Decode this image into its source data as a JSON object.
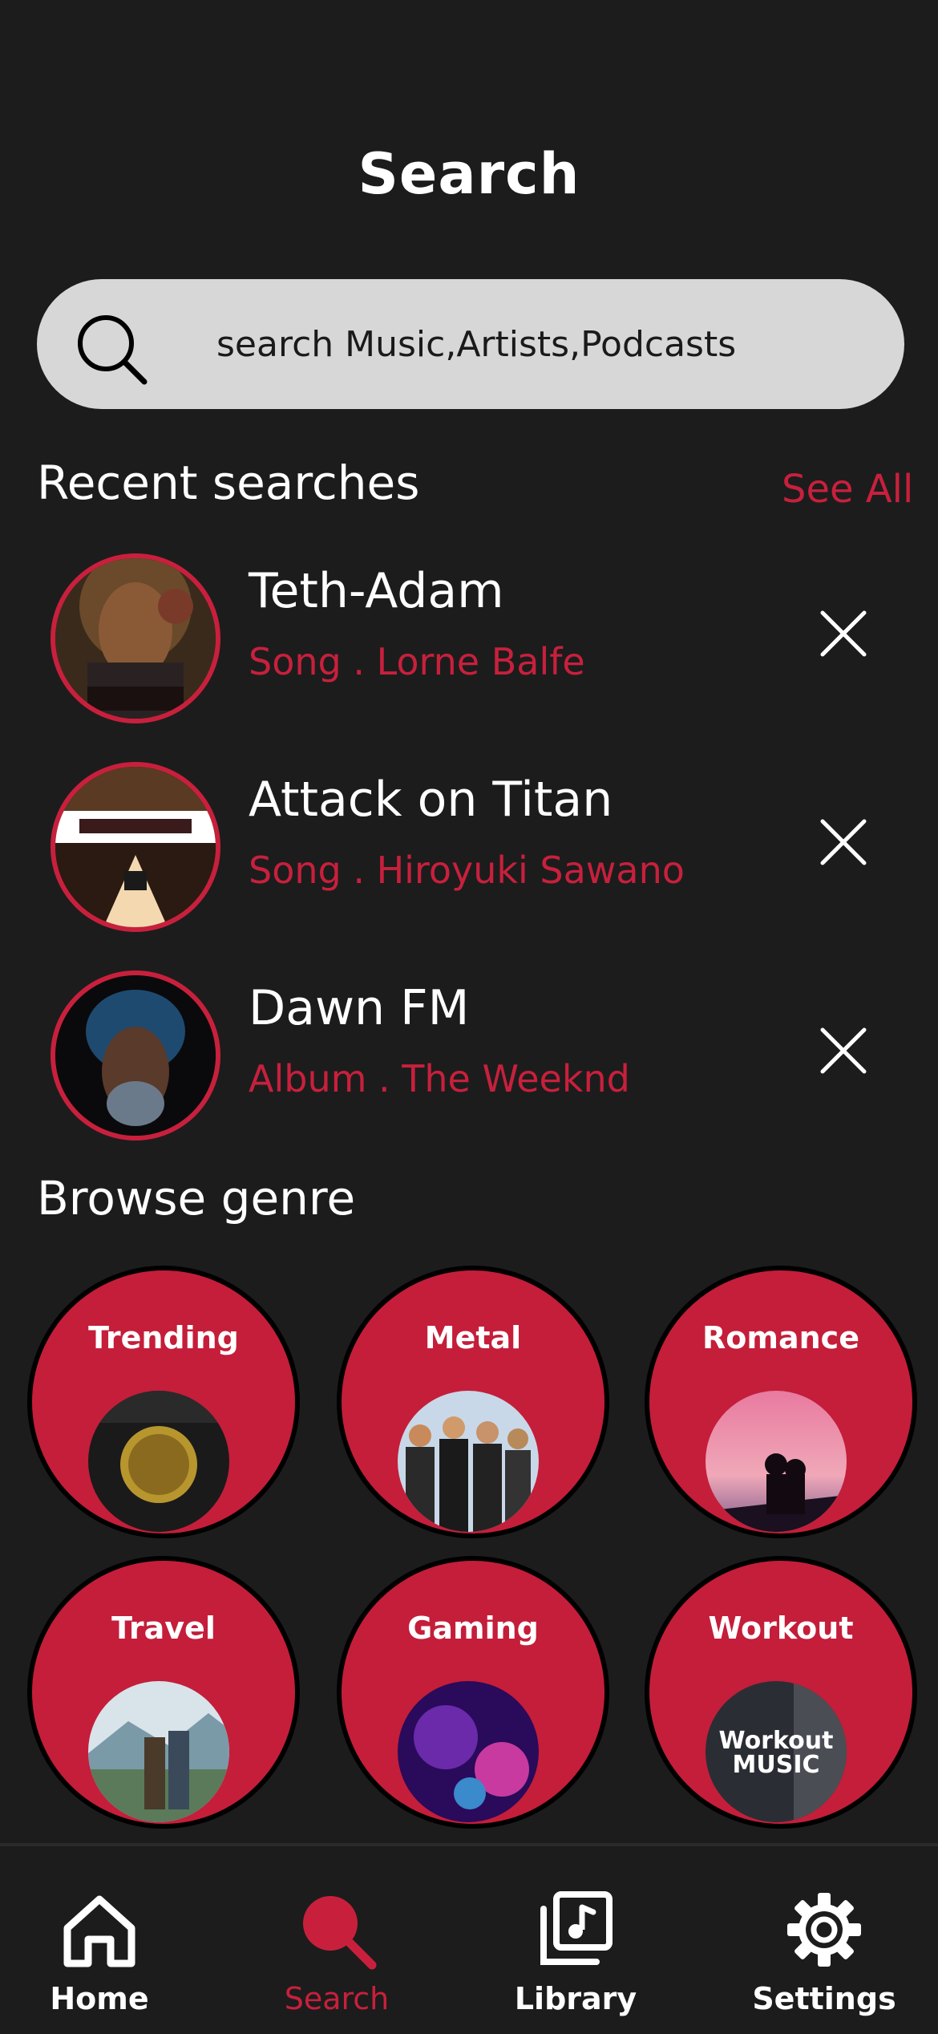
{
  "header": {
    "title": "Search"
  },
  "search": {
    "placeholder": "search Music,Artists,Podcasts"
  },
  "recent": {
    "title": "Recent searches",
    "see_all": "See All",
    "items": [
      {
        "title": "Teth-Adam",
        "subtitle": "Song . Lorne Balfe"
      },
      {
        "title": "Attack on Titan",
        "subtitle": "Song . Hiroyuki Sawano"
      },
      {
        "title": "Dawn FM",
        "subtitle": "Album . The Weeknd"
      }
    ]
  },
  "browse": {
    "title": "Browse genre",
    "genres": [
      {
        "label": "Trending"
      },
      {
        "label": "Metal"
      },
      {
        "label": "Romance"
      },
      {
        "label": "Travel"
      },
      {
        "label": "Gaming"
      },
      {
        "label": "Workout"
      }
    ],
    "workout_thumb_text_1": "Workout",
    "workout_thumb_text_2": "MUSIC"
  },
  "nav": {
    "items": [
      {
        "label": "Home",
        "icon": "home-icon"
      },
      {
        "label": "Search",
        "icon": "search-icon"
      },
      {
        "label": "Library",
        "icon": "library-icon"
      },
      {
        "label": "Settings",
        "icon": "gear-icon"
      }
    ],
    "active": "Search"
  },
  "colors": {
    "background": "#1c1c1d",
    "accent": "#c8203c",
    "search_bar": "#d7d7d7",
    "genre_circle": "#c41e3a"
  }
}
